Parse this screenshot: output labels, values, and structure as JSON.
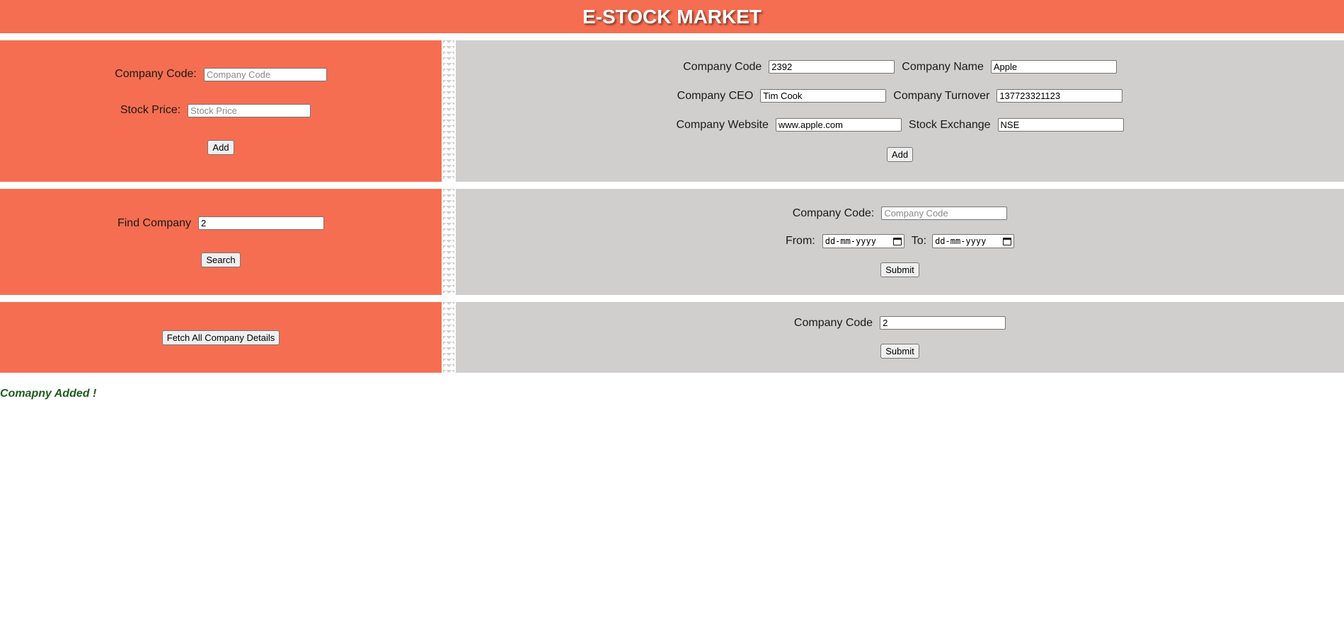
{
  "header": {
    "title": "E-STOCK MARKET"
  },
  "add_stock": {
    "code_label": "Company Code:",
    "code_placeholder": "Company Code",
    "code_value": "",
    "price_label": "Stock Price:",
    "price_placeholder": "Stock Price",
    "price_value": "",
    "button": "Add"
  },
  "register_company": {
    "code_label": "Company Code",
    "code_value": "2392",
    "name_label": "Company Name",
    "name_value": "Apple",
    "ceo_label": "Company CEO",
    "ceo_value": "Tim Cook",
    "turnover_label": "Company Turnover",
    "turnover_value": "137723321123",
    "website_label": "Company Website",
    "website_value": "www.apple.com",
    "exchange_label": "Stock Exchange",
    "exchange_value": "NSE",
    "button": "Add"
  },
  "find_company": {
    "label": "Find Company",
    "value": "2",
    "button": "Search"
  },
  "stock_range": {
    "code_label": "Company Code:",
    "code_placeholder": "Company Code",
    "code_value": "",
    "from_label": "From:",
    "from_placeholder": "dd-mm-yyyy",
    "to_label": "To:",
    "to_placeholder": "dd-mm-yyyy",
    "button": "Submit"
  },
  "fetch_all": {
    "button": "Fetch All Company Details"
  },
  "delete_company": {
    "code_label": "Company Code",
    "code_value": "2",
    "button": "Submit"
  },
  "status": {
    "message": "Comapny Added !",
    "color": "#1d5c1d"
  },
  "colors": {
    "primary": "#f66e51",
    "panel": "#d1cece"
  }
}
